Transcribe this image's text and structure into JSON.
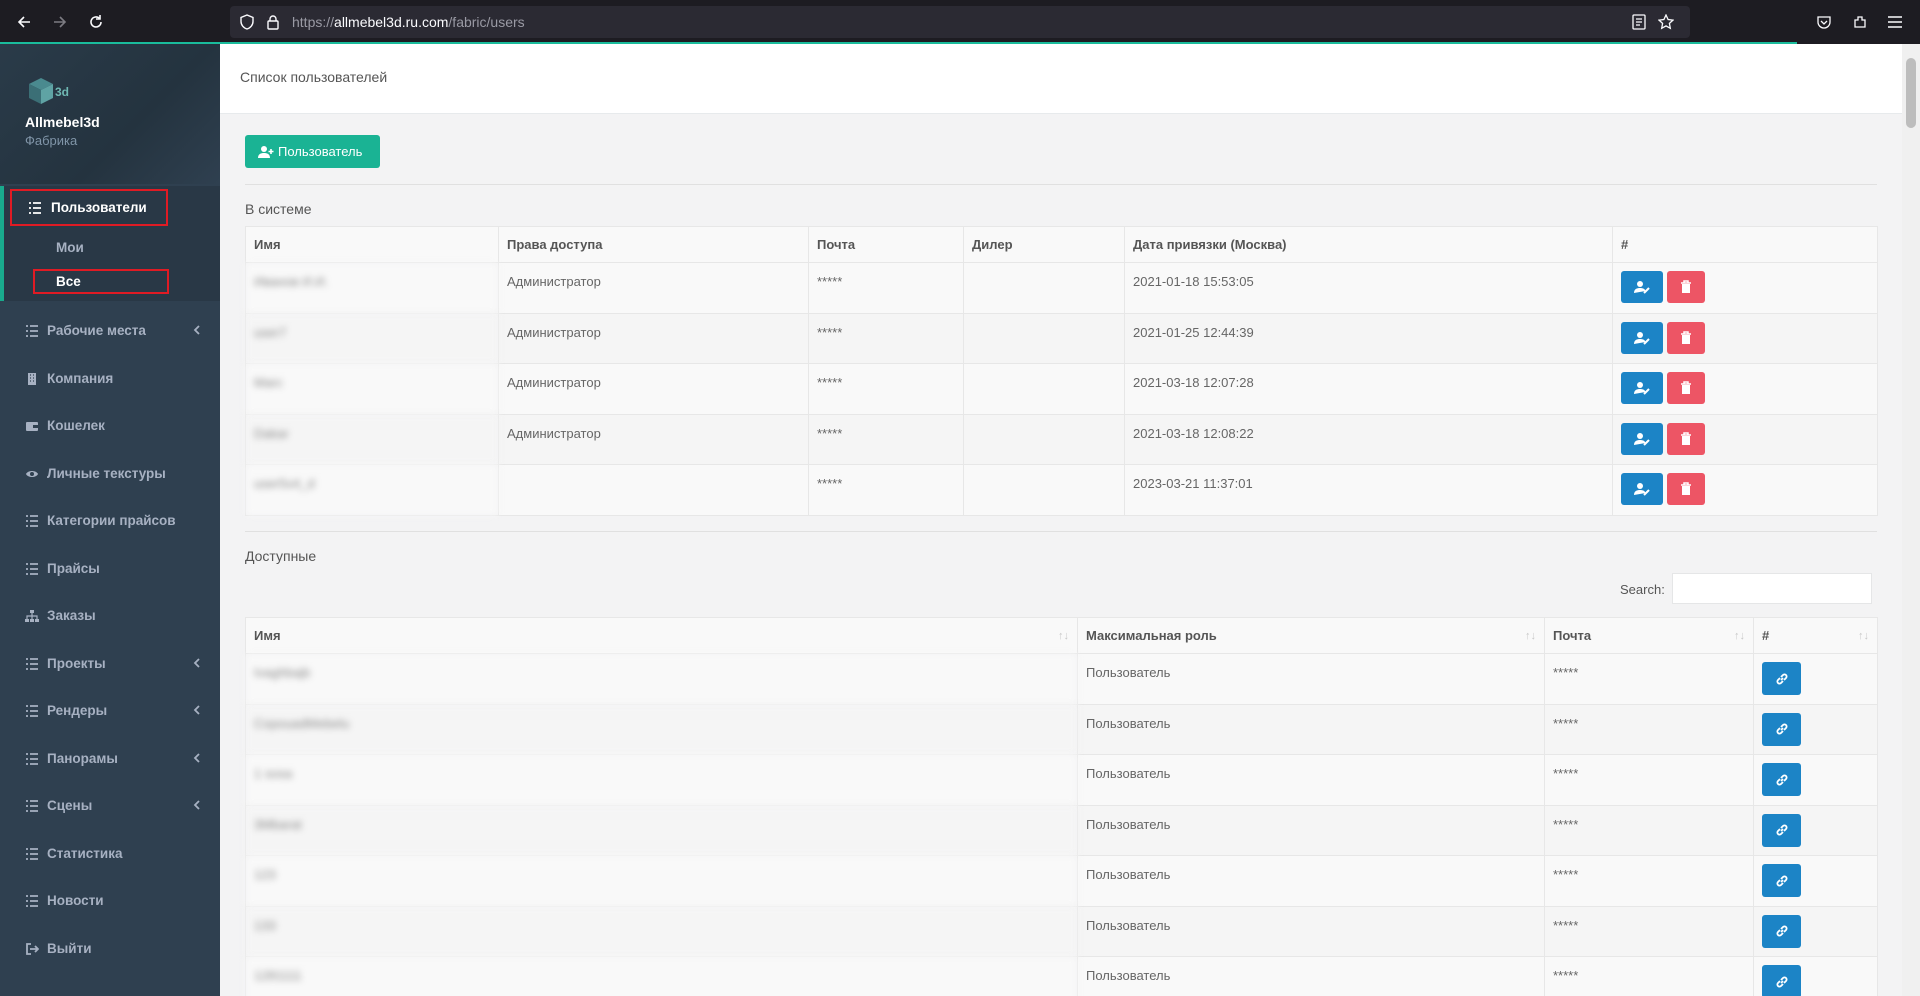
{
  "browser": {
    "url_host": "https://allmebel3d.ru.com",
    "url_path": "/fabric/users"
  },
  "sidebar": {
    "company_name": "Allmebel3d",
    "company_role": "Фабрика",
    "menu": [
      {
        "label": "Пользователи",
        "icon": "list-icon",
        "active": true
      },
      {
        "label": "Рабочие места",
        "icon": "list-icon",
        "has_children": true
      },
      {
        "label": "Компания",
        "icon": "building-icon"
      },
      {
        "label": "Кошелек",
        "icon": "wallet-icon"
      },
      {
        "label": "Личные текстуры",
        "icon": "eye-icon"
      },
      {
        "label": "Категории прайсов",
        "icon": "list-icon"
      },
      {
        "label": "Прайсы",
        "icon": "list-icon"
      },
      {
        "label": "Заказы",
        "icon": "sitemap-icon"
      },
      {
        "label": "Проекты",
        "icon": "list-icon",
        "has_children": true
      },
      {
        "label": "Рендеры",
        "icon": "list-icon",
        "has_children": true
      },
      {
        "label": "Панорамы",
        "icon": "list-icon",
        "has_children": true
      },
      {
        "label": "Сцены",
        "icon": "list-icon",
        "has_children": true
      },
      {
        "label": "Статистика",
        "icon": "list-icon"
      },
      {
        "label": "Новости",
        "icon": "list-icon"
      },
      {
        "label": "Выйти",
        "icon": "sign-out-icon"
      }
    ],
    "submenu": [
      {
        "label": "Мои"
      },
      {
        "label": "Все",
        "active": true
      }
    ]
  },
  "page": {
    "title": "Список пользователей",
    "add_button": "Пользователь",
    "in_system_title": "В системе",
    "available_title": "Доступные",
    "search_label": "Search:",
    "search_value": ""
  },
  "in_system_table": {
    "headers": [
      "Имя",
      "Права доступа",
      "Почта",
      "Дилер",
      "Дата привязки (Москва)",
      "#"
    ],
    "rows": [
      {
        "name": "Иванов И.И.",
        "access": "Администратор",
        "email": "*****",
        "dealer": "",
        "date": "2021-01-18 15:53:05"
      },
      {
        "name": "user7",
        "access": "Администратор",
        "email": "*****",
        "dealer": "",
        "date": "2021-01-25 12:44:39"
      },
      {
        "name": "Marc",
        "access": "Администратор",
        "email": "*****",
        "dealer": "",
        "date": "2021-03-18 12:07:28"
      },
      {
        "name": "Dakar",
        "access": "Администратор",
        "email": "*****",
        "dealer": "",
        "date": "2021-03-18 12:08:22"
      },
      {
        "name": "user5x4_d",
        "access": "",
        "email": "*****",
        "dealer": "",
        "date": "2023-03-21 11:37:01"
      }
    ]
  },
  "available_table": {
    "headers": [
      "Имя",
      "Максимальная роль",
      "Почта",
      "#"
    ],
    "rows": [
      {
        "name": "Ivaghbajb",
        "role": "Пользователь",
        "email": "*****"
      },
      {
        "name": "CopouadMebelu",
        "role": "Пользователь",
        "email": "*****"
      },
      {
        "name": "1 sosa",
        "role": "Пользователь",
        "email": "*****"
      },
      {
        "name": "3Mbarat",
        "role": "Пользователь",
        "email": "*****"
      },
      {
        "name": "123",
        "role": "Пользователь",
        "email": "*****"
      },
      {
        "name": "133",
        "role": "Пользователь",
        "email": "*****"
      },
      {
        "name": "1281111",
        "role": "Пользователь",
        "email": "*****"
      }
    ]
  },
  "colors": {
    "sidebar_bg": "#2f4050",
    "accent": "#1ab394",
    "primary": "#1c84c6",
    "danger": "#ed5565",
    "highlight_box": "#e01b24"
  }
}
